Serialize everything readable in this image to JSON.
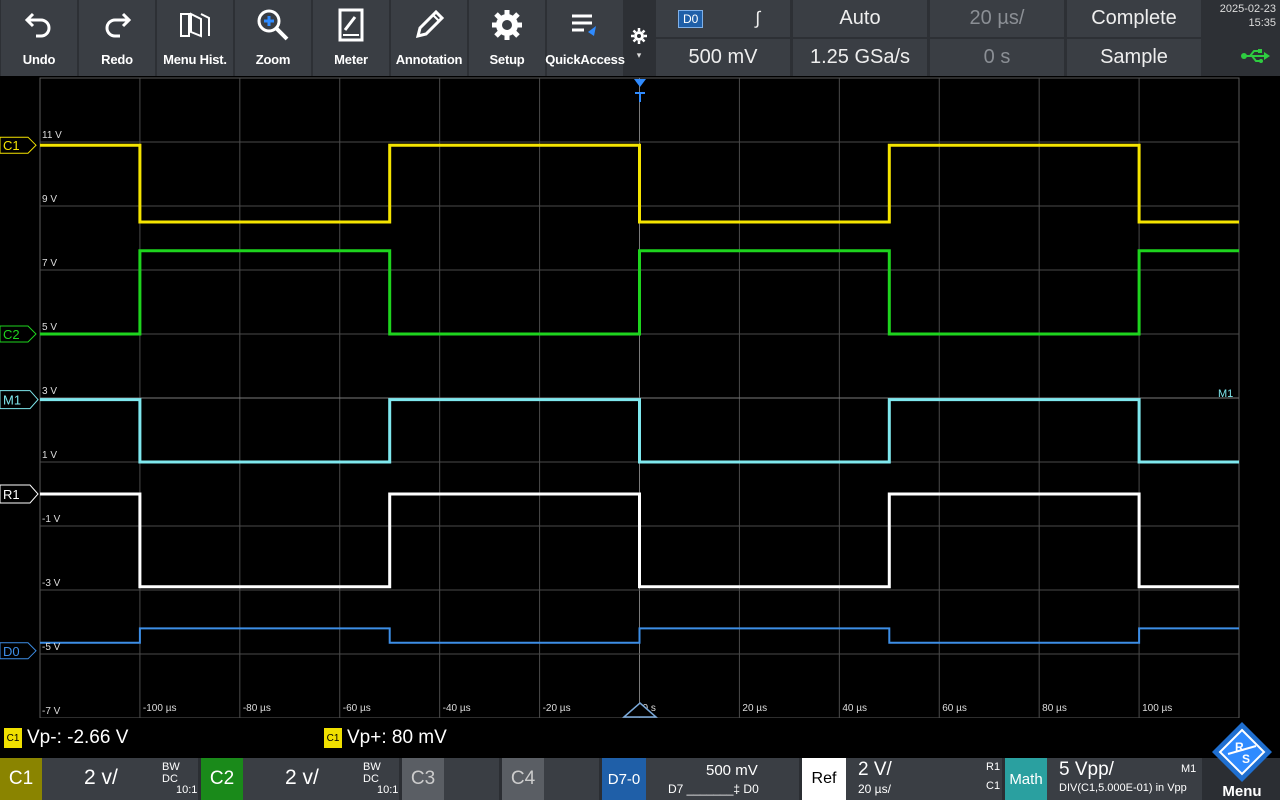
{
  "toolbar": {
    "buttons": [
      {
        "label": "Undo",
        "icon": "undo-icon"
      },
      {
        "label": "Redo",
        "icon": "redo-icon"
      },
      {
        "label": "Menu Hist.",
        "icon": "menu-history-icon"
      },
      {
        "label": "Zoom",
        "icon": "zoom-icon"
      },
      {
        "label": "Meter",
        "icon": "meter-icon"
      },
      {
        "label": "Annotation",
        "icon": "annotation-icon"
      },
      {
        "label": "Setup",
        "icon": "setup-gear-icon"
      },
      {
        "label": "QuickAccess",
        "icon": "quickaccess-icon"
      }
    ]
  },
  "trigger": {
    "source": "D0",
    "slope": "∫",
    "mode": "Auto",
    "time_scale": "20 µs/",
    "acq_state": "Complete",
    "level": "500 mV",
    "sample_rate": "1.25 GSa/s",
    "position": "0 s",
    "acq_mode": "Sample"
  },
  "datetime": {
    "date": "2025-02-23",
    "time": "15:35"
  },
  "plot": {
    "y_labels": [
      "11 V",
      "9 V",
      "7 V",
      "5 V",
      "3 V",
      "1 V",
      "-1 V",
      "-3 V",
      "-5 V",
      "-7 V"
    ],
    "x_labels": [
      "-100 µs",
      "-80 µs",
      "-60 µs",
      "-40 µs",
      "-20 µs",
      "0 s",
      "20 µs",
      "40 µs",
      "60 µs",
      "80 µs",
      "100 µs"
    ],
    "markers": [
      {
        "label": "C1",
        "color": "#f5e400"
      },
      {
        "label": "C2",
        "color": "#1ed41e"
      },
      {
        "label": "M1",
        "color": "#7fe8ee"
      },
      {
        "label": "R1",
        "color": "#ffffff"
      },
      {
        "label": "D0",
        "color": "#3d8ee6"
      }
    ],
    "m1_right_label": "M1"
  },
  "chart_data": {
    "type": "line",
    "xlabel": "",
    "ylabel": "",
    "x_unit": "µs",
    "xlim": [
      -120,
      120
    ],
    "ylim": [
      -7,
      13
    ],
    "grid": true,
    "series": [
      {
        "name": "C1",
        "color": "#f5e400",
        "x": [
          -120,
          -100,
          -100,
          -50,
          -50,
          0,
          0,
          50,
          50,
          100,
          100,
          120
        ],
        "y": [
          10.9,
          10.9,
          8.5,
          8.5,
          10.9,
          10.9,
          8.5,
          8.5,
          10.9,
          10.9,
          8.5,
          8.5
        ]
      },
      {
        "name": "C2",
        "color": "#1ed41e",
        "x": [
          -120,
          -100,
          -100,
          -50,
          -50,
          0,
          0,
          50,
          50,
          100,
          100,
          120
        ],
        "y": [
          5.0,
          5.0,
          7.6,
          7.6,
          5.0,
          5.0,
          7.6,
          7.6,
          5.0,
          5.0,
          7.6,
          7.6
        ]
      },
      {
        "name": "M1",
        "color": "#7fe8ee",
        "x": [
          -120,
          -100,
          -100,
          -50,
          -50,
          0,
          0,
          50,
          50,
          100,
          100,
          120
        ],
        "y": [
          2.95,
          2.95,
          1.0,
          1.0,
          2.95,
          2.95,
          1.0,
          1.0,
          2.95,
          2.95,
          1.0,
          1.0
        ]
      },
      {
        "name": "R1",
        "color": "#ffffff",
        "x": [
          -120,
          -100,
          -100,
          -50,
          -50,
          0,
          0,
          50,
          50,
          100,
          100,
          120
        ],
        "y": [
          0.0,
          0.0,
          -2.9,
          -2.9,
          0.0,
          0.0,
          -2.9,
          -2.9,
          0.0,
          0.0,
          -2.9,
          -2.9
        ]
      },
      {
        "name": "D0",
        "color": "#3d8ee6",
        "x": [
          -120,
          -100,
          -100,
          -50,
          -50,
          0,
          0,
          50,
          50,
          100,
          100,
          120
        ],
        "y": [
          -4.65,
          -4.65,
          -4.2,
          -4.2,
          -4.65,
          -4.65,
          -4.2,
          -4.2,
          -4.65,
          -4.65,
          -4.2,
          -4.2
        ]
      }
    ]
  },
  "measurements": [
    {
      "source": "C1",
      "text": "Vp-: -2.66 V"
    },
    {
      "source": "C1",
      "text": "Vp+: 80 mV"
    }
  ],
  "channels": {
    "c1": {
      "name": "C1",
      "scale": "2 v/",
      "coupling": "BW DC",
      "probe": "10:1",
      "color": "#8a8400"
    },
    "c2": {
      "name": "C2",
      "scale": "2 v/",
      "coupling": "BW DC",
      "probe": "10:1",
      "color": "#1a8a1a"
    },
    "c3": {
      "name": "C3"
    },
    "c4": {
      "name": "C4"
    },
    "digital": {
      "name": "D7-0",
      "level": "500 mV",
      "range": "D7 _______‡ D0"
    },
    "ref": {
      "name": "Ref",
      "scale": "2 V/",
      "time": "20 µs/",
      "id": "R1",
      "src": "C1"
    },
    "math": {
      "name": "Math",
      "scale": "5 Vpp/",
      "id": "M1",
      "expr": "DIV(C1,5.000E-01) in Vpp"
    }
  },
  "menu": {
    "label": "Menu"
  }
}
